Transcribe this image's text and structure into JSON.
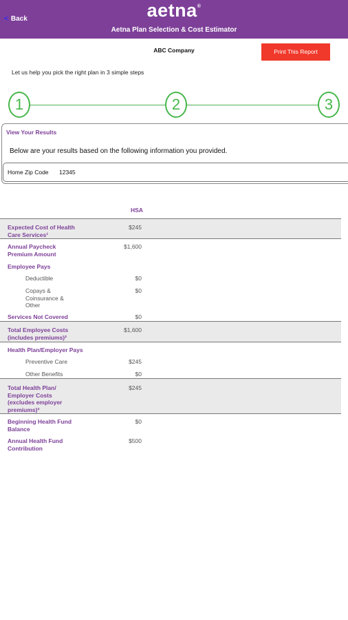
{
  "header": {
    "back_chevron": "<",
    "back_label": "Back",
    "brand": "aetna",
    "brand_mark": "®",
    "subtitle": "Aetna Plan Selection & Cost Estimator"
  },
  "company": "ABC Company",
  "print_button": "Print This Report",
  "intro": "Let us help you pick the right plan in 3 simple steps",
  "steps": [
    "1",
    "2",
    "3"
  ],
  "colors": {
    "brand_purple": "#7d3f98",
    "step_green": "#45b649",
    "print_red": "#f0392b"
  },
  "results": {
    "title": "View Your Results",
    "description": "Below are your results based on the following information you provided.",
    "zip_label": "Home Zip Code",
    "zip_value": "12345"
  },
  "table": {
    "column_header": "HSA",
    "rows": {
      "expected_cost": {
        "label1": "Expected Cost of Health",
        "label2": "Care Services¹",
        "value": "$245"
      },
      "paycheck": {
        "label1": "Annual Paycheck",
        "label2": "Premium Amount",
        "value": "$1,600"
      },
      "employee_pays": {
        "label1": "Employee Pays"
      },
      "deductible": {
        "label1": "Deductible",
        "value": "$0"
      },
      "copays": {
        "label1": "Copays &",
        "label2": "Coinsurance &",
        "label3": "Other",
        "value": "$0"
      },
      "not_covered": {
        "label1": "Services Not Covered",
        "value": "$0"
      },
      "total_employee": {
        "label1": "Total Employee Costs",
        "label2": "(includes premiums)²",
        "value": "$1,600"
      },
      "plan_pays": {
        "label1": "Health Plan/Employer Pays"
      },
      "preventive": {
        "label1": "Preventive Care",
        "value": "$245"
      },
      "other_benefits": {
        "label1": "Other Benefits",
        "value": "$0"
      },
      "total_plan": {
        "label1": "Total Health Plan/",
        "label2": "Employer Costs",
        "label3": "(excludes employer",
        "label4": "premiums)³",
        "value": "$245"
      },
      "beginning_fund": {
        "label1": "Beginning Health Fund",
        "label2": "Balance",
        "value": "$0"
      },
      "annual_fund": {
        "label1": "Annual Health Fund",
        "label2": "Contribution",
        "value": "$500"
      }
    }
  }
}
